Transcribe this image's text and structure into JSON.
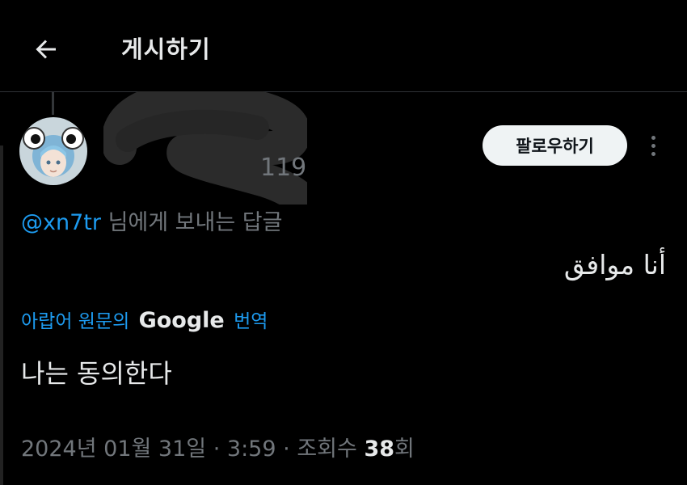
{
  "header": {
    "title": "게시하기",
    "back_icon": "arrow-left-icon"
  },
  "author": {
    "avatar_icon": "anime-avatar-icon",
    "name_visible": "",
    "handle_visible": "119"
  },
  "actions": {
    "follow_label": "팔로우하기",
    "more_icon": "more-vertical-icon"
  },
  "reply": {
    "mention": "@xn7tr",
    "suffix": "님에게 보내는 답글"
  },
  "tweet": {
    "text": "أنا موافق"
  },
  "translation": {
    "prefix": "아랍어 원문의",
    "brand": "Google",
    "suffix": "번역",
    "text": "나는 동의한다"
  },
  "meta": {
    "date": "2024년 01월 31일",
    "sep1": "·",
    "time": "3:59",
    "sep2": "·",
    "views_label": "조회수",
    "views_count": "38",
    "views_unit": "회"
  },
  "colors": {
    "background": "#000000",
    "text": "#e7e9ea",
    "muted": "#71767b",
    "link": "#1d9bf0",
    "follow_bg": "#eff3f4"
  }
}
